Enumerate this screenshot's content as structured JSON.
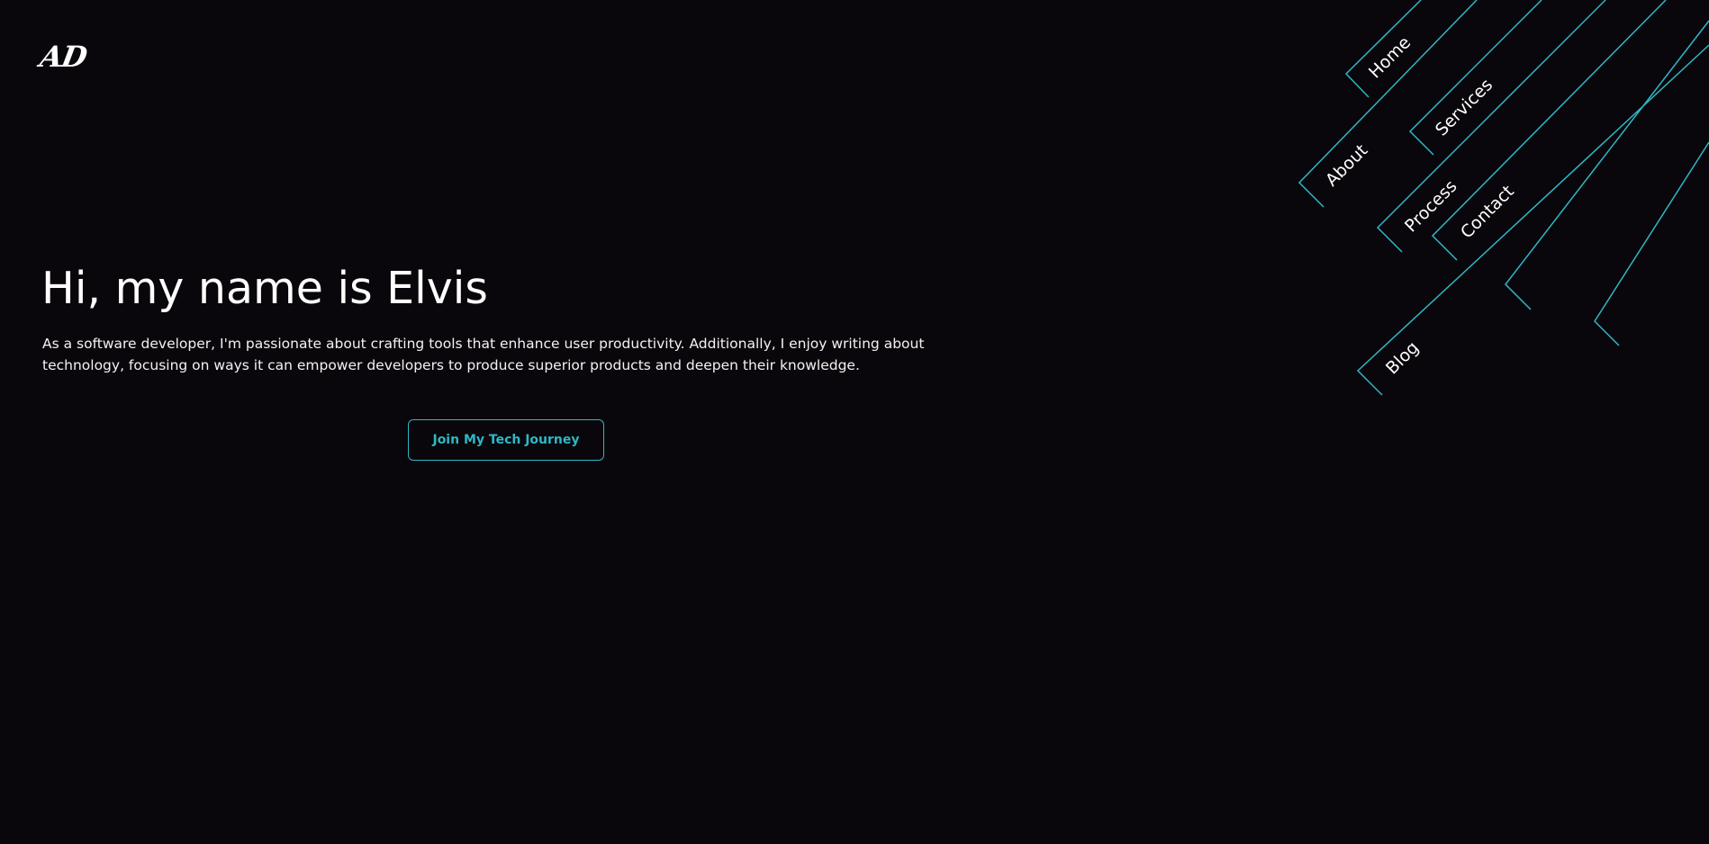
{
  "header": {
    "logo_text": "AD"
  },
  "hero": {
    "title": "Hi, my name is Elvis",
    "description": "As a software developer, I'm passionate about crafting tools that enhance user productivity. Additionally, I enjoy writing about technology, focusing on ways it can empower developers to produce superior products and deepen their knowledge.",
    "cta_label": "Join My Tech Journey"
  },
  "nav": {
    "items": [
      {
        "label": "Home"
      },
      {
        "label": "Services"
      },
      {
        "label": "About"
      },
      {
        "label": "Process"
      },
      {
        "label": "Contact"
      },
      {
        "label": "Blog"
      }
    ]
  },
  "colors": {
    "background": "#09070b",
    "accent": "#2fb7c7",
    "text": "#ffffff"
  }
}
